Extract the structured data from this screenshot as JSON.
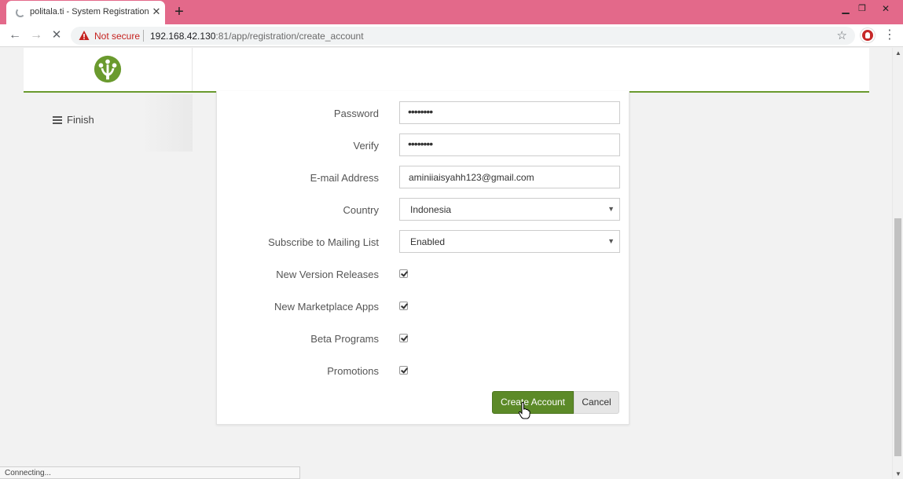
{
  "browser": {
    "tab_title": "politala.ti - System Registration",
    "not_secure_label": "Not secure",
    "url_host": "192.168.42.130",
    "url_rest": ":81/app/registration/create_account"
  },
  "sidebar": {
    "items": [
      {
        "label": "Finish",
        "icon": "list-icon"
      }
    ]
  },
  "form": {
    "password": {
      "label": "Password",
      "value": "••••••••"
    },
    "verify": {
      "label": "Verify",
      "value": "••••••••"
    },
    "email": {
      "label": "E-mail Address",
      "value": "aminiiaisyahh123@gmail.com"
    },
    "country": {
      "label": "Country",
      "value": "Indonesia"
    },
    "mailing": {
      "label": "Subscribe to Mailing List",
      "value": "Enabled"
    },
    "checkboxes": [
      {
        "label": "New Version Releases",
        "checked": true
      },
      {
        "label": "New Marketplace Apps",
        "checked": true
      },
      {
        "label": "Beta Programs",
        "checked": true
      },
      {
        "label": "Promotions",
        "checked": true
      }
    ],
    "create_label": "Create Account",
    "cancel_label": "Cancel"
  },
  "status_text": "Connecting...",
  "colors": {
    "titlebar": "#e3698a",
    "accent_green": "#5c8a28",
    "header_border": "#6a9a2e",
    "not_secure_red": "#c5221f"
  }
}
